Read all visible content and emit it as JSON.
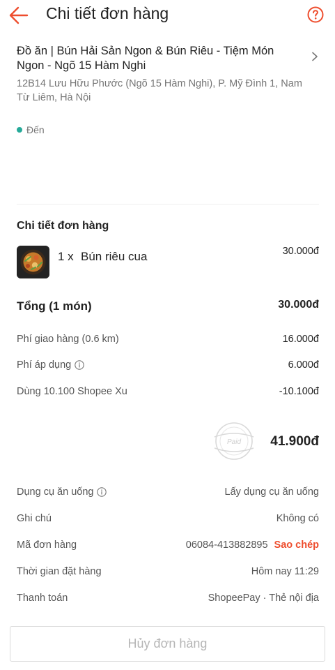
{
  "header": {
    "title": "Chi tiết đơn hàng"
  },
  "restaurant": {
    "name": "Đồ ăn | Bún Hải Sản Ngon & Bún Riêu - Tiệm Món Ngon - Ngõ 15 Hàm Nghi",
    "address": "12B14 Lưu Hữu Phước (Ngõ 15 Hàm Nghi), P. Mỹ Đình 1, Nam Từ Liêm, Hà Nội"
  },
  "status": {
    "label": "Đến",
    "color": "#26aa99"
  },
  "order_details": {
    "section_title": "Chi tiết đơn hàng",
    "items": [
      {
        "qty": "1 x",
        "name": "Bún riêu cua",
        "price": "30.000đ"
      }
    ],
    "total_label": "Tổng (1 món)",
    "total_value": "30.000đ",
    "fees": [
      {
        "label": "Phí giao hàng (0.6 km)",
        "value": "16.000đ",
        "info_icon": false
      },
      {
        "label": "Phí áp dụng",
        "value": "6.000đ",
        "info_icon": true
      },
      {
        "label": "Dùng 10.100 Shopee Xu",
        "value": "-10.100đ",
        "info_icon": false
      }
    ],
    "paid_stamp": "Paid",
    "grand_total": "41.900đ"
  },
  "info": {
    "utensils_label": "Dụng cụ ăn uống",
    "utensils_value": "Lấy dụng cụ ăn uống",
    "note_label": "Ghi chú",
    "note_value": "Không có",
    "order_id_label": "Mã đơn hàng",
    "order_id_value": "06084-413882895",
    "copy_label": "Sao chép",
    "order_time_label": "Thời gian đặt hàng",
    "order_time_value": "Hôm nay 11:29",
    "payment_label": "Thanh toán",
    "payment_value": "ShopeePay · Thẻ nội địa"
  },
  "cancel_button": "Hủy đơn hàng",
  "colors": {
    "accent": "#ee4d2d",
    "status": "#26aa99"
  },
  "icons": [
    "back-arrow-icon",
    "help-icon",
    "chevron-right-icon",
    "info-icon",
    "paid-stamp-icon"
  ]
}
